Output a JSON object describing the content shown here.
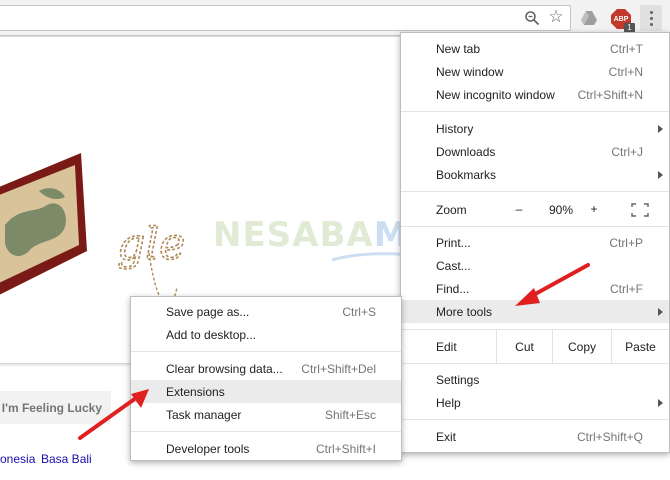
{
  "toolbar": {
    "icons": [
      "zoom-icon",
      "star-icon",
      "drive-icon",
      "adblock-plus-icon",
      "menu-dots-icon"
    ],
    "abp_label": "ABP",
    "abp_count": "1"
  },
  "page": {
    "lucky_button": "I'm Feeling Lucky",
    "languages": [
      "onesia",
      "Basa Bali"
    ],
    "doodle_text": "gle"
  },
  "watermark": {
    "part1": "NESABA",
    "part2": "MEDIA"
  },
  "chrome_menu": {
    "new_tab": {
      "label": "New tab",
      "shortcut": "Ctrl+T"
    },
    "new_window": {
      "label": "New window",
      "shortcut": "Ctrl+N"
    },
    "new_incognito": {
      "label": "New incognito window",
      "shortcut": "Ctrl+Shift+N"
    },
    "history": {
      "label": "History"
    },
    "downloads": {
      "label": "Downloads",
      "shortcut": "Ctrl+J"
    },
    "bookmarks": {
      "label": "Bookmarks"
    },
    "zoom": {
      "label": "Zoom",
      "minus": "–",
      "value": "90%",
      "plus": "+"
    },
    "print": {
      "label": "Print...",
      "shortcut": "Ctrl+P"
    },
    "cast": {
      "label": "Cast..."
    },
    "find": {
      "label": "Find...",
      "shortcut": "Ctrl+F"
    },
    "more_tools": {
      "label": "More tools"
    },
    "edit": {
      "label": "Edit",
      "cut": "Cut",
      "copy": "Copy",
      "paste": "Paste"
    },
    "settings": {
      "label": "Settings"
    },
    "help": {
      "label": "Help"
    },
    "exit": {
      "label": "Exit",
      "shortcut": "Ctrl+Shift+Q"
    }
  },
  "more_tools_menu": {
    "save_page": {
      "label": "Save page as...",
      "shortcut": "Ctrl+S"
    },
    "add_desktop": {
      "label": "Add to desktop..."
    },
    "clear_data": {
      "label": "Clear browsing data...",
      "shortcut": "Ctrl+Shift+Del"
    },
    "extensions": {
      "label": "Extensions"
    },
    "task_manager": {
      "label": "Task manager",
      "shortcut": "Shift+Esc"
    },
    "dev_tools": {
      "label": "Developer tools",
      "shortcut": "Ctrl+Shift+I"
    }
  },
  "colors": {
    "highlight": "#ebebeb",
    "arrow_red": "#e02020",
    "link_blue": "#1a0dab"
  }
}
